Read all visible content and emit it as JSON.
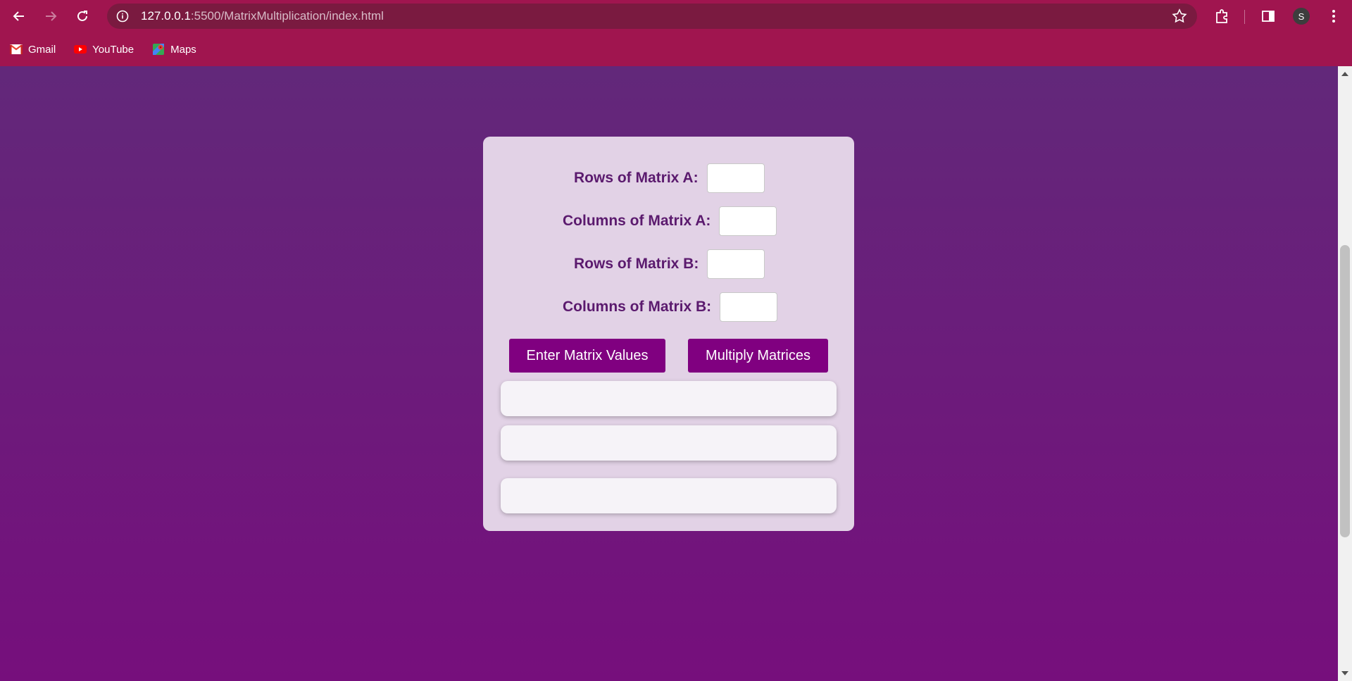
{
  "browser": {
    "url_host": "127.0.0.1",
    "url_rest": ":5500/MatrixMultiplication/index.html",
    "profile_initial": "S",
    "bookmarks": [
      {
        "label": "Gmail",
        "icon": "gmail-icon"
      },
      {
        "label": "YouTube",
        "icon": "youtube-icon"
      },
      {
        "label": "Maps",
        "icon": "maps-icon"
      }
    ]
  },
  "form": {
    "rows_a_label": "Rows of Matrix A:",
    "cols_a_label": "Columns of Matrix A:",
    "rows_b_label": "Rows of Matrix B:",
    "cols_b_label": "Columns of Matrix B:",
    "rows_a_value": "",
    "cols_a_value": "",
    "rows_b_value": "",
    "cols_b_value": ""
  },
  "buttons": {
    "enter_label": "Enter Matrix Values",
    "multiply_label": "Multiply Matrices"
  },
  "colors": {
    "browser_accent": "#a0154f",
    "page_background": "#6a1f7a",
    "card_background": "#e2d2e6",
    "button": "#800080",
    "label_text": "#5b1a6e"
  }
}
